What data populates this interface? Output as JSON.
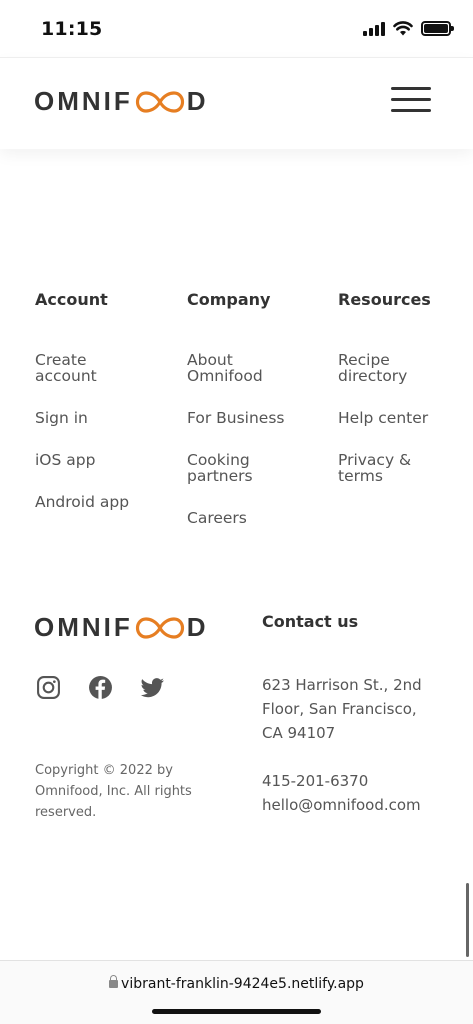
{
  "status_bar": {
    "time": "11:15",
    "icons": [
      "cellular-signal-icon",
      "wifi-icon",
      "battery-icon"
    ]
  },
  "header": {
    "logo": {
      "before": "OMNIF",
      "after": "D",
      "icon": "infinity-icon",
      "accent": "#e67e22"
    },
    "menu_icon": "hamburger-menu-icon"
  },
  "footer": {
    "columns": [
      {
        "title": "Account",
        "links": [
          "Create account",
          "Sign in",
          "iOS app",
          "Android app"
        ]
      },
      {
        "title": "Company",
        "links": [
          "About Omnifood",
          "For Business",
          "Cooking partners",
          "Careers"
        ]
      },
      {
        "title": "Resources",
        "links": [
          "Recipe directory",
          "Help center",
          "Privacy & terms"
        ]
      }
    ],
    "socials": [
      "instagram-icon",
      "facebook-icon",
      "twitter-icon"
    ],
    "copyright": "Copyright © 2022 by Omnifood, Inc. All rights reserved.",
    "contact": {
      "title": "Contact us",
      "address": "623 Harrison St., 2nd Floor, San Francisco, CA 94107",
      "phone": "415-201-6370",
      "email": "hello@omnifood.com"
    }
  },
  "browser": {
    "url": "vibrant-franklin-9424e5.netlify.app"
  },
  "colors": {
    "accent": "#e67e22",
    "text_dark": "#333333",
    "text": "#555555"
  }
}
